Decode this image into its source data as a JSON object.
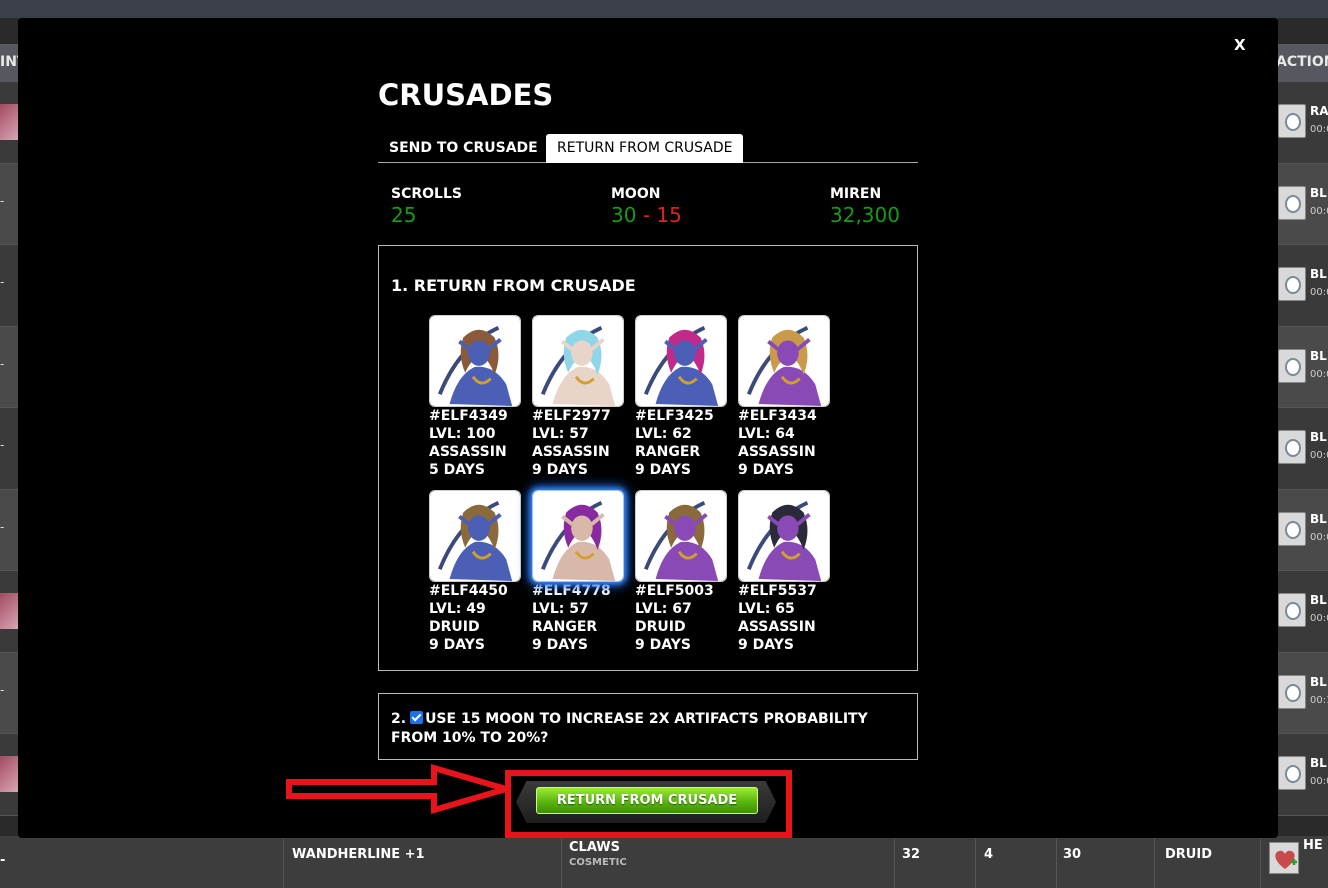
{
  "background": {
    "header_left": "INT",
    "header_right": "ACTION",
    "row_left_values": [
      "",
      "-",
      "-",
      "-",
      "-",
      "-",
      "",
      "-",
      ""
    ],
    "right_labels": [
      "RA",
      "BL",
      "BL",
      "BL",
      "BL",
      "BL",
      "BL",
      "BL",
      "BL"
    ],
    "right_times": [
      "00:0",
      "00:0",
      "00:0",
      "00:0",
      "00:0",
      "00:0",
      "00:0",
      "00:1",
      "00:0"
    ],
    "last_row": {
      "left": "-",
      "item": "WANDHERLINE +1",
      "type": "CLAWS",
      "subtype": "COSMETIC",
      "col1": "32",
      "col2": "4",
      "col3": "30",
      "class": "DRUID",
      "action": "HE"
    }
  },
  "modal": {
    "close_label": "X",
    "title": "CRUSADES",
    "tabs": [
      {
        "label": "SEND TO CRUSADE",
        "active": false
      },
      {
        "label": "RETURN FROM CRUSADE",
        "active": true
      }
    ],
    "stats": {
      "scrolls": {
        "label": "SCROLLS",
        "value": "25"
      },
      "moon": {
        "label": "MOON",
        "value_a": "30",
        "sep": "-",
        "value_b": "15"
      },
      "miren": {
        "label": "MIREN",
        "value": "32,300"
      }
    },
    "section1_title": "1. RETURN FROM CRUSADE",
    "elves": [
      {
        "id": "#ELF4349",
        "level": "LVL: 100",
        "class": "ASSASSIN",
        "days": "5 DAYS",
        "selected": false,
        "skin": "#4a5fb5",
        "hair": "#8a5a3a"
      },
      {
        "id": "#ELF2977",
        "level": "LVL: 57",
        "class": "ASSASSIN",
        "days": "9 DAYS",
        "selected": false,
        "skin": "#e8d4c8",
        "hair": "#8fd6e8"
      },
      {
        "id": "#ELF3425",
        "level": "LVL: 62",
        "class": "RANGER",
        "days": "9 DAYS",
        "selected": false,
        "skin": "#4a5fb5",
        "hair": "#c22a8a"
      },
      {
        "id": "#ELF3434",
        "level": "LVL: 64",
        "class": "ASSASSIN",
        "days": "9 DAYS",
        "selected": false,
        "skin": "#8a4ab5",
        "hair": "#c89a4a"
      },
      {
        "id": "#ELF4450",
        "level": "LVL: 49",
        "class": "DRUID",
        "days": "9 DAYS",
        "selected": false,
        "skin": "#4a5fb5",
        "hair": "#8a6a3a"
      },
      {
        "id": "#ELF4778",
        "level": "LVL: 57",
        "class": "RANGER",
        "days": "9 DAYS",
        "selected": true,
        "skin": "#d8b8a8",
        "hair": "#8a2aa0"
      },
      {
        "id": "#ELF5003",
        "level": "LVL: 67",
        "class": "DRUID",
        "days": "9 DAYS",
        "selected": false,
        "skin": "#8a4ab5",
        "hair": "#8a6a3a"
      },
      {
        "id": "#ELF5537",
        "level": "LVL: 65",
        "class": "ASSASSIN",
        "days": "9 DAYS",
        "selected": false,
        "skin": "#8a4ab5",
        "hair": "#2a2a3a"
      }
    ],
    "section2_prefix": "2.",
    "section2_text": "USE 15 MOON TO INCREASE 2X ARTIFACTS PROBABILITY FROM 10% TO 20%?",
    "section2_checked": true,
    "submit_label": "RETURN FROM CRUSADE"
  },
  "colors": {
    "positive": "#169c16",
    "negative": "#e02020",
    "highlight": "#e8141c",
    "button": "#6ccc1a",
    "selected_glow": "#3b8cff"
  }
}
